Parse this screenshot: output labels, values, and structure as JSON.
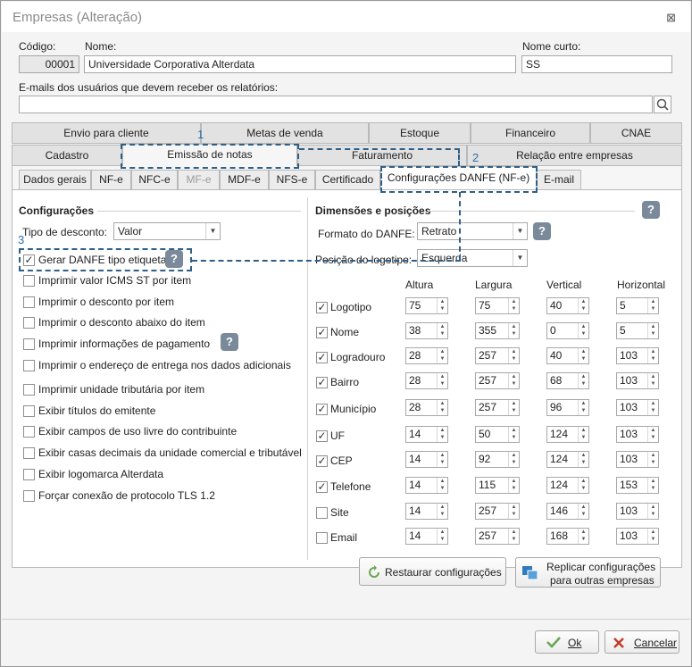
{
  "window": {
    "title": "Empresas (Alteração)",
    "close": "⊠"
  },
  "header": {
    "codigo_label": "Código:",
    "codigo_value": "00001",
    "nome_label": "Nome:",
    "nome_value": "Universidade Corporativa Alterdata",
    "nome_curto_label": "Nome curto:",
    "nome_curto_value": "SS",
    "emails_label": "E-mails dos usuários que devem receber os relatórios:",
    "emails_value": ""
  },
  "tabs_row1": [
    "Envio para cliente",
    "Metas de venda",
    "Estoque",
    "Financeiro",
    "CNAE"
  ],
  "tabs_row2": [
    "Cadastro",
    "Emissão de notas",
    "Faturamento",
    "Relação entre empresas"
  ],
  "subtabs": [
    "Dados gerais",
    "NF-e",
    "NFC-e",
    "MF-e",
    "MDF-e",
    "NFS-e",
    "Certificado",
    "Configurações DANFE (NF-e)",
    "E-mail"
  ],
  "left": {
    "section": "Configurações",
    "tipo_desconto_label": "Tipo de desconto:",
    "tipo_desconto_value": "Valor",
    "options": [
      {
        "label": "Gerar DANFE tipo etiqueta",
        "checked": true
      },
      {
        "label": "Imprimir valor ICMS ST por item",
        "checked": false
      },
      {
        "label": "Imprimir o desconto por item",
        "checked": false
      },
      {
        "label": "Imprimir o desconto abaixo do item",
        "checked": false
      },
      {
        "label": "Imprimir informações de pagamento",
        "checked": false
      },
      {
        "label": "Imprimir o endereço de entrega nos dados adicionais",
        "checked": false
      },
      {
        "label": "Imprimir unidade tributária por item",
        "checked": false
      },
      {
        "label": "Exibir títulos do emitente",
        "checked": false
      },
      {
        "label": "Exibir campos de uso livre do contribuinte",
        "checked": false
      },
      {
        "label": "Exibir casas decimais da unidade comercial e tributável",
        "checked": false
      },
      {
        "label": "Exibir logomarca Alterdata",
        "checked": false
      },
      {
        "label": "Forçar conexão de protocolo TLS 1.2",
        "checked": false
      }
    ]
  },
  "right": {
    "section": "Dimensões e posições",
    "formato_label": "Formato do DANFE:",
    "formato_value": "Retrato",
    "posicao_label": "Posição do logotipo:",
    "posicao_value": "Esquerda",
    "columns": [
      "Altura",
      "Largura",
      "Vertical",
      "Horizontal"
    ],
    "rows": [
      {
        "label": "Logotipo",
        "checked": true,
        "values": [
          "75",
          "75",
          "40",
          "5"
        ]
      },
      {
        "label": "Nome",
        "checked": true,
        "values": [
          "38",
          "355",
          "0",
          "5"
        ]
      },
      {
        "label": "Logradouro",
        "checked": true,
        "values": [
          "28",
          "257",
          "40",
          "103"
        ]
      },
      {
        "label": "Bairro",
        "checked": true,
        "values": [
          "28",
          "257",
          "68",
          "103"
        ]
      },
      {
        "label": "Município",
        "checked": true,
        "values": [
          "28",
          "257",
          "96",
          "103"
        ]
      },
      {
        "label": "UF",
        "checked": true,
        "values": [
          "14",
          "50",
          "124",
          "103"
        ]
      },
      {
        "label": "CEP",
        "checked": true,
        "values": [
          "14",
          "92",
          "124",
          "103"
        ]
      },
      {
        "label": "Telefone",
        "checked": true,
        "values": [
          "14",
          "115",
          "124",
          "153"
        ]
      },
      {
        "label": "Site",
        "checked": false,
        "values": [
          "14",
          "257",
          "146",
          "103"
        ]
      },
      {
        "label": "Email",
        "checked": false,
        "values": [
          "14",
          "257",
          "168",
          "103"
        ]
      }
    ],
    "restore_label": "Restaurar configurações",
    "replicate_label_1": "Replicar configurações",
    "replicate_label_2": "para outras empresas"
  },
  "footer": {
    "ok_label": "Ok",
    "cancel_label": "Cancelar"
  },
  "annotations": [
    "1",
    "2",
    "3"
  ],
  "colors": {
    "annotation": "#2f5f86",
    "ok_check": "#6aa84f",
    "cancel_x": "#c0392b"
  }
}
